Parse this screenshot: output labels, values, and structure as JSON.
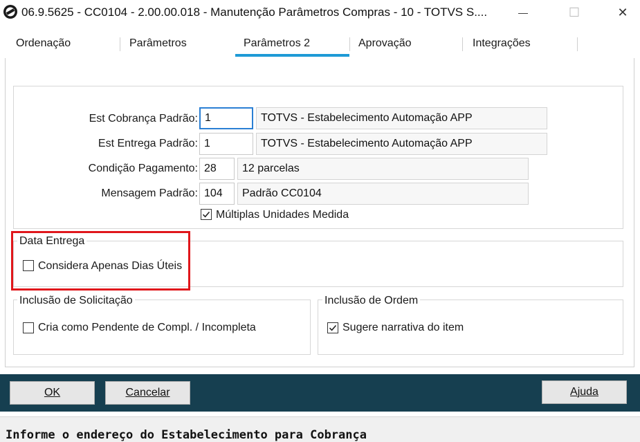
{
  "window": {
    "title": "06.9.5625 - CC0104 - 2.00.00.018 - Manutenção Parâmetros Compras - 10 - TOTVS S....",
    "icon": "totvs-logo-icon",
    "minimize_glyph": "—",
    "maximize_glyph": "☐",
    "close_glyph": "✕"
  },
  "tabs": [
    {
      "label": "Ordenação"
    },
    {
      "label": "Parâmetros"
    },
    {
      "label": "Parâmetros 2",
      "selected": true
    },
    {
      "label": "Aprovação"
    },
    {
      "label": "Integrações"
    }
  ],
  "form": {
    "est_cobranca": {
      "label": "Est Cobrança Padrão:",
      "value": "1",
      "description": "TOTVS - Estabelecimento Automação APP"
    },
    "est_entrega": {
      "label": "Est Entrega Padrão:",
      "value": "1",
      "description": "TOTVS - Estabelecimento Automação APP"
    },
    "condicao_pagamento": {
      "label": "Condição Pagamento:",
      "value": "28",
      "description": "12 parcelas"
    },
    "mensagem_padrao": {
      "label": "Mensagem Padrão:",
      "value": "104",
      "description": "Padrão CC0104"
    },
    "multiplas_unidades": {
      "label": "Múltiplas Unidades Medida",
      "checked": true
    }
  },
  "data_entrega": {
    "title": "Data Entrega",
    "considera_dias_uteis": {
      "label": "Considera Apenas Dias Úteis",
      "checked": false
    }
  },
  "inclusao_solicitacao": {
    "title": "Inclusão de Solicitação",
    "cria_pendente": {
      "label": "Cria como Pendente de Compl. / Incompleta",
      "checked": false
    }
  },
  "inclusao_ordem": {
    "title": "Inclusão de Ordem",
    "sugere_narrativa": {
      "label": "Sugere narrativa do item",
      "checked": true
    }
  },
  "buttons": {
    "ok": "OK",
    "cancelar": "Cancelar",
    "ajuda": "Ajuda"
  },
  "status_bar": {
    "message": "Informe o endereço do Estabelecimento para Cobrança"
  },
  "colors": {
    "tab_accent": "#1e9ad6",
    "button_bar": "#163f50",
    "highlight": "#e0161b",
    "active_field_border": "#2a7fd4"
  }
}
